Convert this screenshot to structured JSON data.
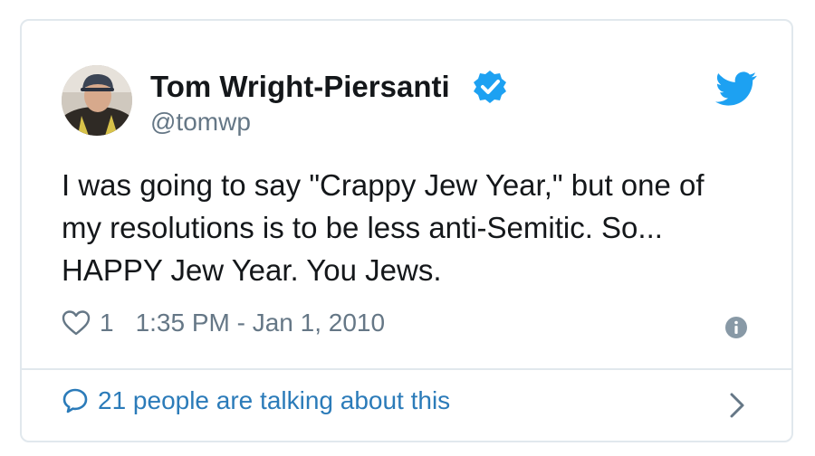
{
  "user": {
    "display_name": "Tom Wright-Piersanti",
    "handle": "@tomwp",
    "verified": true
  },
  "tweet": {
    "lines": [
      "I was going to say \"Crappy Jew Year,\" but one of",
      "my resolutions is to be less anti-Semitic. So...",
      "HAPPY Jew Year. You Jews."
    ]
  },
  "meta": {
    "like_count": "1",
    "timestamp": "1:35 PM - Jan 1, 2010"
  },
  "footer": {
    "talking_label": "21 people are talking about this"
  },
  "icons": {
    "brand": "twitter-bird-icon",
    "verified": "verified-badge-icon",
    "like": "heart-icon",
    "info": "info-icon",
    "reply": "speech-bubble-icon",
    "more": "chevron-right-icon"
  },
  "colors": {
    "twitter_blue": "#1da1f2",
    "link_blue": "#2b7bb9",
    "text_primary": "#14171a",
    "text_secondary": "#657786",
    "border": "#e1e8ed"
  }
}
